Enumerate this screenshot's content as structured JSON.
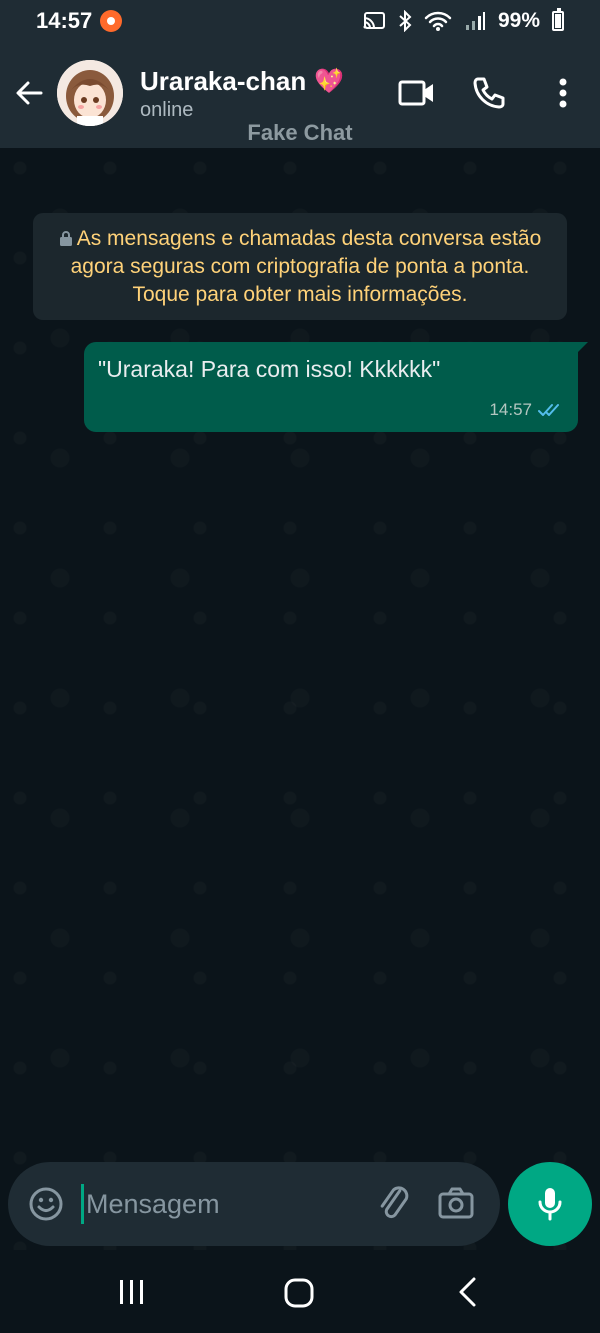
{
  "status_bar": {
    "time": "14:57",
    "battery": "99%"
  },
  "header": {
    "contact_name": "Uraraka-chan",
    "heart_emoji": "💖",
    "contact_status": "online",
    "watermark": "Fake Chat"
  },
  "chat": {
    "encryption_notice": "As mensagens e chamadas desta conversa estão agora seguras com criptografia de ponta a ponta. Toque para obter mais informações.",
    "messages": [
      {
        "text": "\"Uraraka! Para com isso! Kkkkkk\"",
        "time": "14:57",
        "status": "read"
      }
    ]
  },
  "composer": {
    "placeholder": "Mensagem"
  },
  "colors": {
    "header_bg": "#1f2c34",
    "chat_bg": "#0b141a",
    "outgoing_bubble": "#005c4b",
    "accent": "#00a884",
    "read_ticks": "#53bdeb",
    "notice_text": "#ffd279"
  },
  "icons": {
    "back": "arrow-left-icon",
    "video": "video-call-icon",
    "call": "phone-icon",
    "menu": "more-vert-icon",
    "emoji": "emoji-icon",
    "attach": "paperclip-icon",
    "camera": "camera-icon",
    "mic": "mic-icon"
  }
}
